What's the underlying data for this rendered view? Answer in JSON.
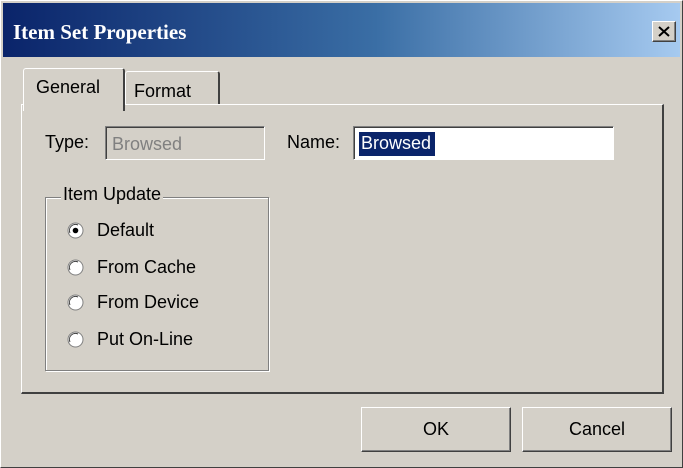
{
  "window": {
    "title": "Item Set Properties"
  },
  "tabs": [
    {
      "label": "General",
      "selected": true
    },
    {
      "label": "Format",
      "selected": false
    }
  ],
  "general": {
    "type_label": "Type:",
    "type_value": "Browsed",
    "name_label": "Name:",
    "name_value": "Browsed",
    "item_update": {
      "legend": "Item Update",
      "options": [
        {
          "label": "Default",
          "selected": true
        },
        {
          "label": "From Cache",
          "selected": false
        },
        {
          "label": "From Device",
          "selected": false
        },
        {
          "label": "Put On-Line",
          "selected": false
        }
      ]
    }
  },
  "buttons": {
    "ok": "OK",
    "cancel": "Cancel"
  },
  "colors": {
    "title_start": "#0a246a",
    "title_end": "#a6caf0",
    "face": "#d4d0c8",
    "selection": "#0a246a"
  }
}
